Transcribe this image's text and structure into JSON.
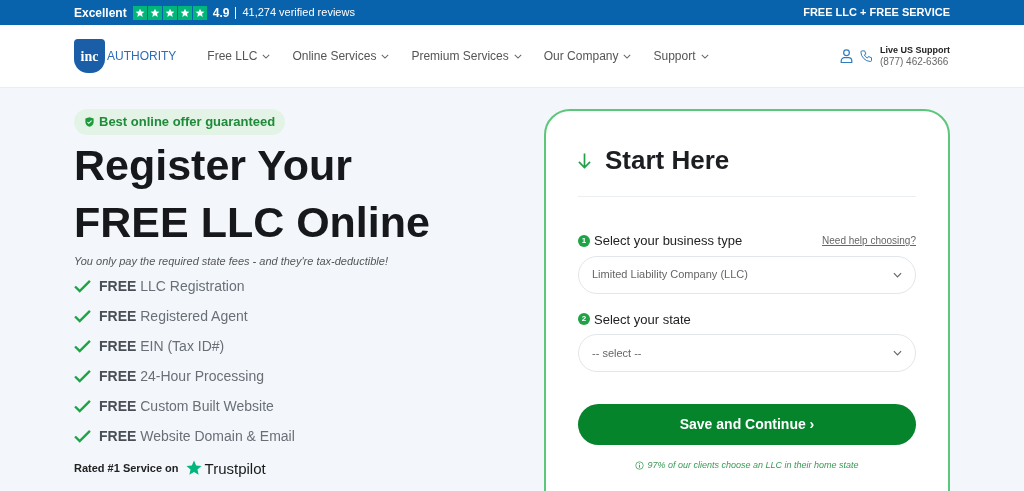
{
  "topbar": {
    "rating_label": "Excellent",
    "stars": 5,
    "score": "4.9",
    "reviews": "41,274 verified reviews",
    "promo": "FREE LLC + FREE SERVICE"
  },
  "logo": {
    "mark": "inc",
    "name": "AUTHORITY"
  },
  "nav": [
    "Free LLC",
    "Online Services",
    "Premium Services",
    "Our Company",
    "Support"
  ],
  "support": {
    "title": "Live US Support",
    "phone": "(877) 462-6366"
  },
  "hero": {
    "badge": "Best online offer guaranteed",
    "headline": [
      "Register Your",
      "FREE LLC Online"
    ],
    "subtitle": "You only pay the required state fees - and they're tax-deductible!",
    "features": [
      "**FREE** LLC Registration",
      "**FREE** Registered Agent",
      "**FREE** EIN (Tax ID#)",
      "**FREE** 24-Hour Processing",
      "**FREE** Custom Built Website",
      "**FREE** Website Domain & Email"
    ],
    "rated": "Rated #1 Service on",
    "trustpilot": "Trustpilot"
  },
  "form": {
    "title": "Start Here",
    "fields": [
      {
        "step": "1",
        "label": "Select your business type",
        "help": "Need help choosing?",
        "value": "Limited Liability Company (LLC)"
      },
      {
        "step": "2",
        "label": "Select your state",
        "value": "-- select --"
      }
    ],
    "submit": "Save and Continue ›",
    "note": "97% of our clients choose an LLC in their home state"
  }
}
